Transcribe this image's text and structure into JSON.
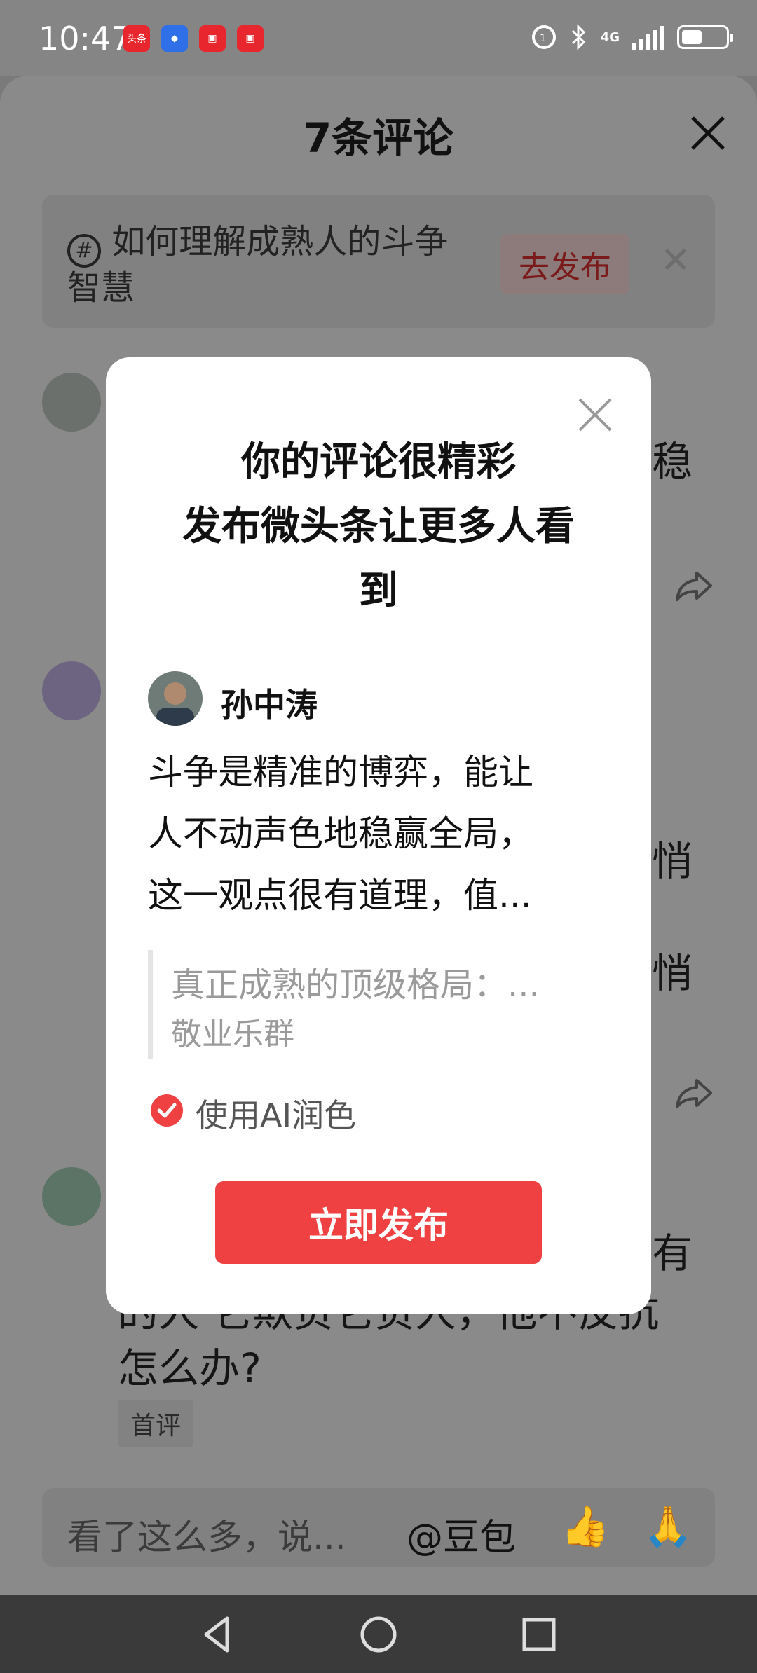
{
  "status": {
    "time": "10:47",
    "network": "4G"
  },
  "sheet": {
    "title": "7条评论",
    "topic": {
      "text": "如何理解成熟人的斗争智慧",
      "publish": "去发布"
    },
    "background_fragments": [
      "稳",
      "悄",
      "悄",
      "有",
      "的人 它欺负它负人，他不反抗",
      "怎么办?"
    ],
    "badge": "首评",
    "input": {
      "placeholder": "看了这么多，说...",
      "mention": "@豆包",
      "emoji1": "👍",
      "emoji2": "🙏"
    }
  },
  "modal": {
    "title_line1": "你的评论很精彩",
    "title_line2": "发布微头条让更多人看",
    "title_line3": "到",
    "user": "孙中涛",
    "body_line1": "斗争是精准的博弈，能让",
    "body_line2": "人不动声色地稳赢全局，",
    "body_line3": "这一观点很有道理，值...",
    "quote_title": "真正成熟的顶级格局：...",
    "quote_source": "敬业乐群",
    "ai_label": "使用AI润色",
    "publish_button": "立即发布"
  },
  "colors": {
    "accent": "#f04142",
    "overlay": "#8a8a8a"
  }
}
